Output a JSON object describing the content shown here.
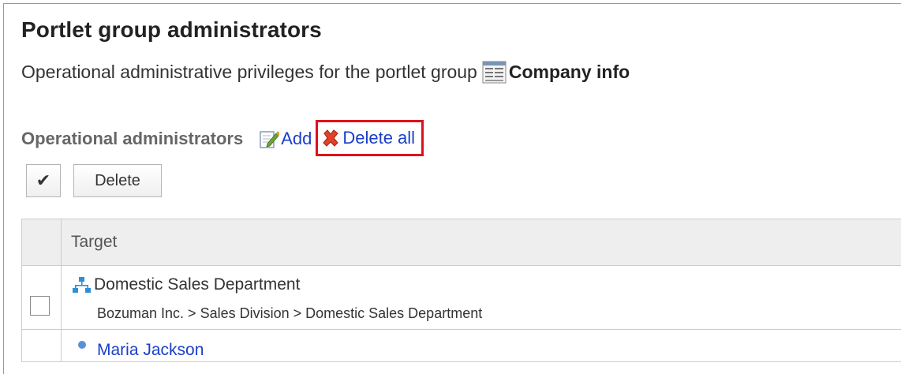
{
  "header": {
    "title": "Portlet group administrators",
    "description": "Operational administrative privileges for the portlet group",
    "group_name": "Company info"
  },
  "section": {
    "title": "Operational administrators",
    "add_label": "Add",
    "delete_all_label": "Delete all",
    "highlight_color": "#e0101a"
  },
  "toolbar": {
    "check_label": "✔",
    "delete_label": "Delete"
  },
  "table": {
    "column_target": "Target",
    "rows": [
      {
        "name": "Domestic Sales Department",
        "path": "Bozuman Inc. > Sales Division > Domestic Sales Department",
        "icon": "organization-icon"
      },
      {
        "name": "Maria Jackson",
        "icon": "user-icon"
      }
    ]
  },
  "colors": {
    "link": "#1a3fc8",
    "header_bg": "#eeeeee",
    "border": "#cccccc"
  }
}
